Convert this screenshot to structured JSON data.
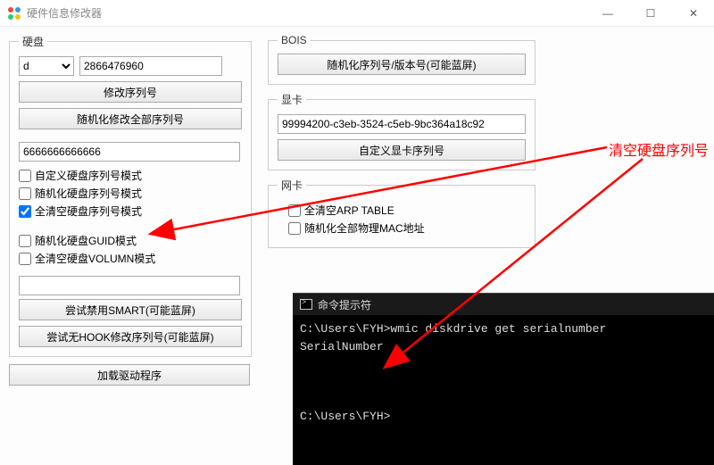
{
  "window": {
    "title": "硬件信息修改器"
  },
  "hdd": {
    "legend": "硬盘",
    "drive_selected": "d",
    "serial": "2866476960",
    "btn_modify": "修改序列号",
    "btn_random_all": "随机化修改全部序列号",
    "custom_value": "6666666666666",
    "chk_custom": "自定义硬盘序列号模式",
    "chk_random": "随机化硬盘序列号模式",
    "chk_clear": "全清空硬盘序列号模式",
    "chk_random_guid": "随机化硬盘GUID模式",
    "chk_clear_volumn": "全清空硬盘VOLUMN模式",
    "empty_input": "",
    "btn_disable_smart": "尝试禁用SMART(可能蓝屏)",
    "btn_nohook": "尝试无HOOK修改序列号(可能蓝屏)"
  },
  "bios": {
    "legend": "BOIS",
    "btn_random": "随机化序列号/版本号(可能蓝屏)"
  },
  "gpu": {
    "legend": "显卡",
    "serial": "99994200-c3eb-3524-c5eb-9bc364a18c92",
    "btn_custom": "自定义显卡序列号"
  },
  "nic": {
    "legend": "网卡",
    "chk_clear_arp": "全清空ARP TABLE",
    "chk_random_mac": "随机化全部物理MAC地址"
  },
  "footer": {
    "btn_load_driver": "加载驱动程序"
  },
  "console": {
    "title": "命令提示符",
    "line1": "C:\\Users\\FYH>wmic diskdrive get serialnumber",
    "line2": "SerialNumber",
    "prompt": "C:\\Users\\FYH>"
  },
  "annotation": {
    "label": "清空硬盘序列号"
  }
}
